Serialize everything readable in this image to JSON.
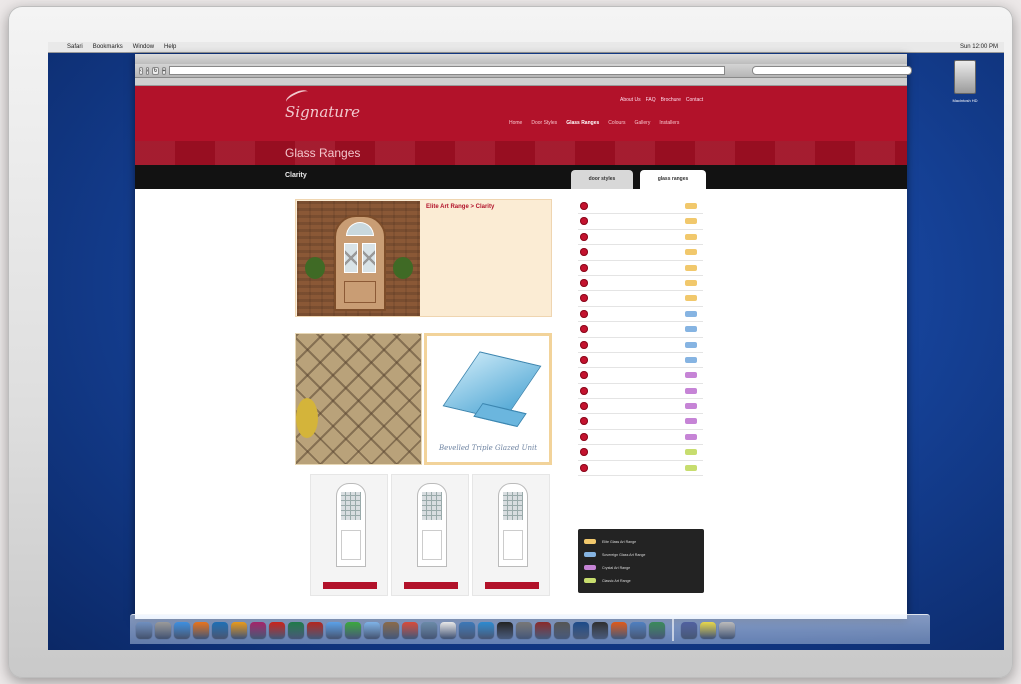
{
  "mac_menu": {
    "apple": "",
    "items": [
      "Safari",
      "Bookmarks",
      "Window",
      "Help"
    ],
    "clock": "Sun 12:00 PM"
  },
  "browser": {
    "window_title": "",
    "url": "",
    "search_placeholder": "",
    "bookmarks": ""
  },
  "site": {
    "logo_text": "Signature",
    "logo_subtext": "",
    "util_nav": [
      "About Us",
      "FAQ",
      "Brochure",
      "Contact"
    ],
    "main_nav": [
      {
        "label": "Home",
        "active": false
      },
      {
        "label": "Door Styles",
        "active": false
      },
      {
        "label": "Glass Ranges",
        "active": true
      },
      {
        "label": "Colours",
        "active": false
      },
      {
        "label": "Gallery",
        "active": false
      },
      {
        "label": "Installers",
        "active": false
      }
    ],
    "section_title": "Glass Ranges",
    "range_title": "Clarity",
    "tabs": [
      "door styles",
      "glass ranges"
    ]
  },
  "product": {
    "heading": "Elite Art Range > Clarity",
    "paragraph_1": "",
    "paragraph_2": ""
  },
  "diagram": {
    "caption": "Bevelled Triple Glazed Unit",
    "sub": "",
    "callouts": [
      "",
      "",
      "",
      ""
    ]
  },
  "thumbnails": [
    {
      "name": "",
      "button": ""
    },
    {
      "name": "",
      "button": ""
    },
    {
      "name": "",
      "button": ""
    }
  ],
  "glass_list": [
    {
      "name": "",
      "swatch": "#f1c86c"
    },
    {
      "name": "",
      "swatch": "#f1c86c"
    },
    {
      "name": "",
      "swatch": "#f1c86c"
    },
    {
      "name": "",
      "swatch": "#f1c86c"
    },
    {
      "name": "",
      "swatch": "#f1c86c"
    },
    {
      "name": "",
      "swatch": "#f1c86c"
    },
    {
      "name": "",
      "swatch": "#f1c86c"
    },
    {
      "name": "",
      "swatch": "#86b4e2"
    },
    {
      "name": "",
      "swatch": "#86b4e2"
    },
    {
      "name": "",
      "swatch": "#86b4e2"
    },
    {
      "name": "",
      "swatch": "#86b4e2"
    },
    {
      "name": "",
      "swatch": "#c684d6"
    },
    {
      "name": "",
      "swatch": "#c684d6"
    },
    {
      "name": "",
      "swatch": "#c684d6"
    },
    {
      "name": "",
      "swatch": "#c684d6"
    },
    {
      "name": "",
      "swatch": "#c684d6"
    },
    {
      "name": "",
      "swatch": "#c7dd6e"
    },
    {
      "name": "",
      "swatch": "#c7dd6e"
    }
  ],
  "legend": [
    {
      "label": "Elite Glass Art Range",
      "swatch": "#f1c86c"
    },
    {
      "label": "Sovereign Glass Art Range",
      "swatch": "#86b4e2"
    },
    {
      "label": "Crystal Art Range",
      "swatch": "#c684d6"
    },
    {
      "label": "Classic Art Range",
      "swatch": "#c7dd6e"
    }
  ],
  "desktop": {
    "hd_label": "Macintosh HD"
  },
  "dock_icons": [
    "finder-icon",
    "system-preferences-icon",
    "safari-icon",
    "firefox-icon",
    "photoshop-icon",
    "illustrator-icon",
    "indesign-icon",
    "acrobat-icon",
    "dreamweaver-icon",
    "flash-icon",
    "itunes-icon",
    "ichat-icon",
    "mail-icon",
    "address-book-icon",
    "ical-icon",
    "preview-icon",
    "textedit-icon",
    "iphoto-icon",
    "itunes-store-icon",
    "terminal-icon",
    "calculator-icon",
    "dictionary-icon",
    "camera-icon",
    "quicktime-icon",
    "dashboard-icon",
    "firefox-2-icon",
    "mail-2-icon",
    "transmit-icon",
    "xcode-icon",
    "stickies-icon",
    "trash-icon"
  ],
  "colors": {
    "brand_red": "#b2122a",
    "band_red": "#9f0f23",
    "nav_black": "#121212"
  }
}
